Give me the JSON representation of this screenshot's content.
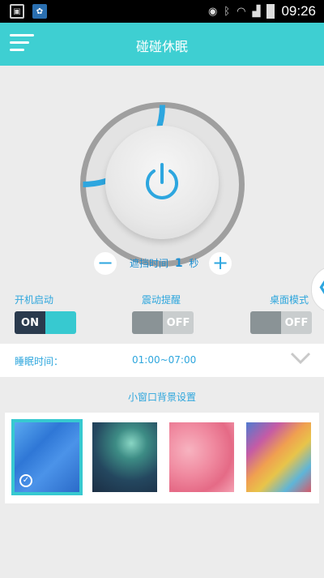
{
  "status_bar": {
    "time": "09:26",
    "icons": [
      "image-icon",
      "app-icon",
      "eye-icon",
      "bluetooth-icon",
      "wifi-icon",
      "signal-icon",
      "battery-icon"
    ]
  },
  "app_bar": {
    "title": "碰碰休眠",
    "menu_icon": "hamburger-menu-icon"
  },
  "power": {
    "icon": "power-icon",
    "progress": 0.25,
    "accent": "#2da6df"
  },
  "delay": {
    "label_prefix": "遮挡时间",
    "value": "1",
    "unit": "秒",
    "minus_label": "−",
    "plus_label": "+"
  },
  "options": {
    "startup": {
      "label": "开机启动",
      "state_label": "ON"
    },
    "vibrate": {
      "label": "震动提醒",
      "state_label": "OFF"
    },
    "desktop": {
      "label": "桌面模式",
      "state_label": "OFF"
    }
  },
  "sleep": {
    "label": "睡眠时间：",
    "range": "01:00~07:00"
  },
  "background": {
    "title": "小窗口背景设置",
    "thumbnails": [
      "blue-background-thumbnail",
      "dark-green-nebula-thumbnail",
      "pink-background-thumbnail",
      "colorful-geometric-thumbnail"
    ],
    "selected_index": 0
  },
  "colors": {
    "teal": "#3ecfd2",
    "blue": "#2da6df",
    "dark": "#2a3a4d"
  }
}
